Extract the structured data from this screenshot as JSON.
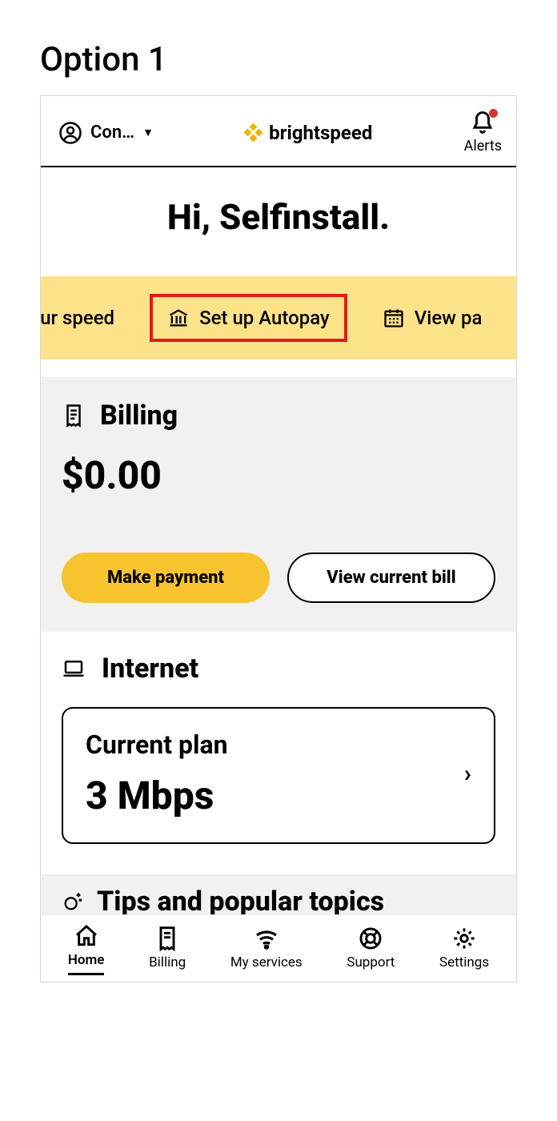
{
  "page_heading": "Option 1",
  "header": {
    "account_name": "Con…",
    "brand": "brightspeed",
    "alerts_label": "Alerts"
  },
  "greeting": "Hi, Selfinstall.",
  "strip": {
    "improve_speed": "ove your speed",
    "autopay": "Set up Autopay",
    "view_past": "View pa"
  },
  "billing": {
    "title": "Billing",
    "amount": "$0.00",
    "make_payment": "Make payment",
    "view_bill": "View current bill"
  },
  "internet": {
    "title": "Internet",
    "plan_label": "Current plan",
    "plan_value": "3 Mbps"
  },
  "tips": {
    "title": "Tips and popular topics"
  },
  "nav": {
    "home": "Home",
    "billing": "Billing",
    "services": "My services",
    "support": "Support",
    "settings": "Settings"
  }
}
